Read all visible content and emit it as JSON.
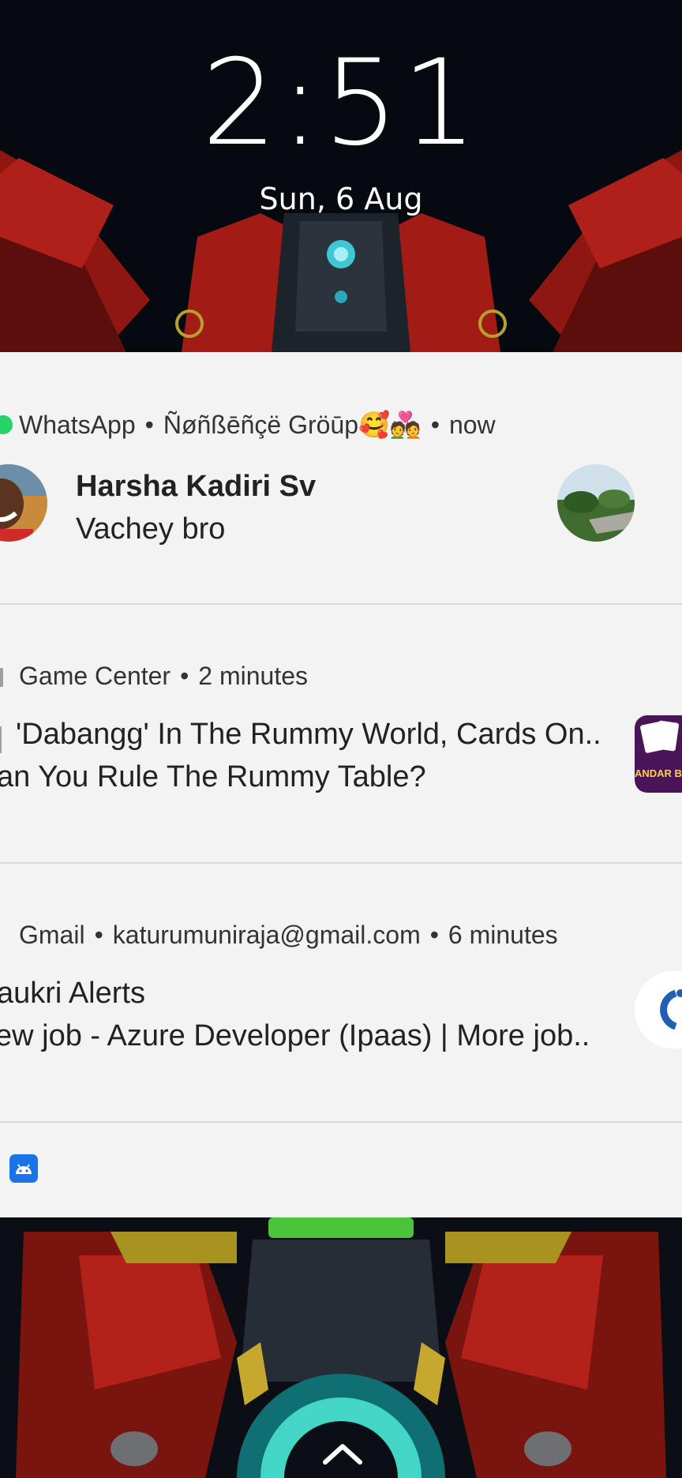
{
  "lockscreen": {
    "time": "2:51",
    "date": "Sun, 6 Aug"
  },
  "notifications": [
    {
      "app": "WhatsApp",
      "subtitle": "Ñøñßēñçë Gröūp🥰💑",
      "time": "now",
      "sender": "Harsha Kadiri Sv",
      "message": "Vachey bro"
    },
    {
      "app": "Game Center",
      "time": "2 minutes",
      "line1": "'Dabangg' In The Rummy World, Cards On..",
      "line2": "an You Rule The Rummy Table?",
      "thumbnail_text": "ANDAR BAHAR KING"
    },
    {
      "app": "Gmail",
      "account": "katurumuniraja@gmail.com",
      "time": "6 minutes",
      "line1": "aukri Alerts",
      "line2": "ew job - Azure Developer (Ipaas) | More job.."
    }
  ],
  "footer_icon": "android-robot-icon",
  "colors": {
    "shade_background": "#f3f3f3",
    "whatsapp_green": "#25d366",
    "gmail_red": "#ea4335",
    "android_blue": "#1a73e8"
  }
}
